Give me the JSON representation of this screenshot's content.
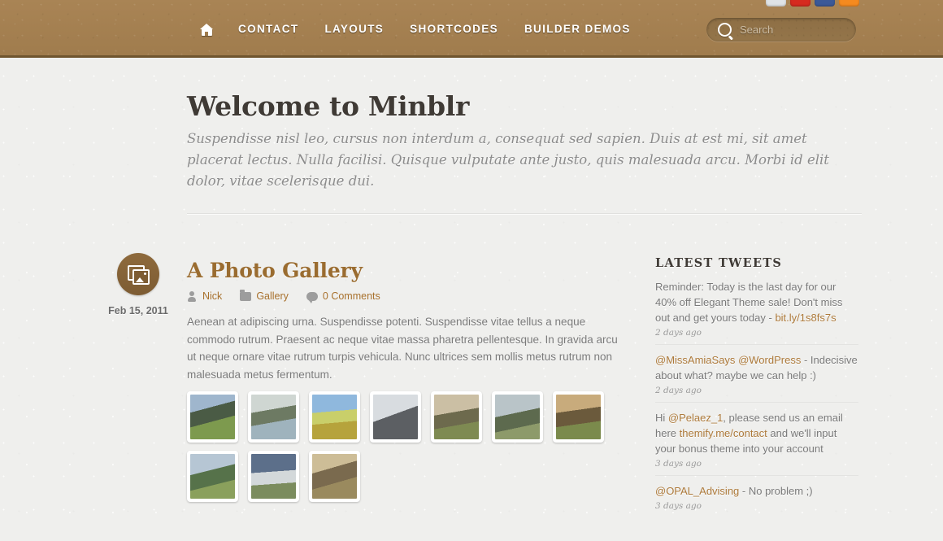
{
  "header": {
    "nav": [
      {
        "label": "Home",
        "icon": "home-icon"
      },
      {
        "label": "CONTACT"
      },
      {
        "label": "LAYOUTS"
      },
      {
        "label": "SHORTCODES"
      },
      {
        "label": "BUILDER DEMOS"
      }
    ],
    "social": [
      {
        "name": "twitter-icon",
        "color": "#dfe3e6"
      },
      {
        "name": "youtube-icon",
        "color": "#d62a1f"
      },
      {
        "name": "facebook-icon",
        "color": "#3b5998"
      },
      {
        "name": "rss-icon",
        "color": "#f58a1f"
      }
    ],
    "search": {
      "placeholder": "Search",
      "value": "",
      "icon": "search-icon"
    },
    "bar_color": "#a98455"
  },
  "intro": {
    "title": "Welcome to Minblr",
    "tagline": "Suspendisse nisl leo, cursus non interdum a, consequat sed sapien. Duis at est mi, sit amet placerat lectus. Nulla facilisi. Quisque vulputate ante justo, quis malesuada arcu. Morbi id elit dolor, vitae scelerisque dui."
  },
  "post": {
    "date": "Feb 15, 2011",
    "date_icon": "gallery-icon",
    "title": "A Photo Gallery",
    "meta": {
      "author_icon": "person-icon",
      "author": "Nick",
      "category_icon": "folder-icon",
      "category": "Gallery",
      "comments_icon": "comment-icon",
      "comments": "0 Comments"
    },
    "body": "Aenean at adipiscing urna. Suspendisse potenti. Suspendisse vitae tellus a neque commodo rutrum. Praesent ac neque vitae massa pharetra pellentesque. In gravida arcu ut neque ornare vitae rutrum turpis vehicula. Nunc ultrices sem mollis metus rutrum non malesuada metus fermentum.",
    "gallery": [
      {
        "name": "thumb-valley-church"
      },
      {
        "name": "thumb-person-by-river"
      },
      {
        "name": "thumb-woman-in-field"
      },
      {
        "name": "thumb-photographer"
      },
      {
        "name": "thumb-woman-sitting-field"
      },
      {
        "name": "thumb-person-on-bench"
      },
      {
        "name": "thumb-person-by-barn"
      },
      {
        "name": "thumb-scooter-riders"
      },
      {
        "name": "thumb-sofa-in-field"
      },
      {
        "name": "thumb-people-at-farm"
      }
    ]
  },
  "sidebar": {
    "heading": "LATEST TWEETS",
    "tweets": [
      {
        "parts": [
          {
            "t": "Reminder: Today is the last day for our 40% off Elegant Theme sale! Don't miss out and get yours today - ",
            "link": false
          },
          {
            "t": "bit.ly/1s8fs7s",
            "link": true
          }
        ],
        "ago": "2 days ago"
      },
      {
        "parts": [
          {
            "t": "@MissAmiaSays",
            "link": true
          },
          {
            "t": " ",
            "link": false
          },
          {
            "t": "@WordPress",
            "link": true
          },
          {
            "t": " - Indecisive about what? maybe we can help :)",
            "link": false
          }
        ],
        "ago": "2 days ago"
      },
      {
        "parts": [
          {
            "t": "Hi ",
            "link": false
          },
          {
            "t": "@Pelaez_1",
            "link": true
          },
          {
            "t": ", please send us an email here ",
            "link": false
          },
          {
            "t": "themify.me/contact",
            "link": true
          },
          {
            "t": " and we'll input your bonus theme into your account",
            "link": false
          }
        ],
        "ago": "3 days ago"
      },
      {
        "parts": [
          {
            "t": "@OPAL_Advising",
            "link": true
          },
          {
            "t": " - No problem ;)",
            "link": false
          }
        ],
        "ago": "3 days ago"
      }
    ]
  }
}
